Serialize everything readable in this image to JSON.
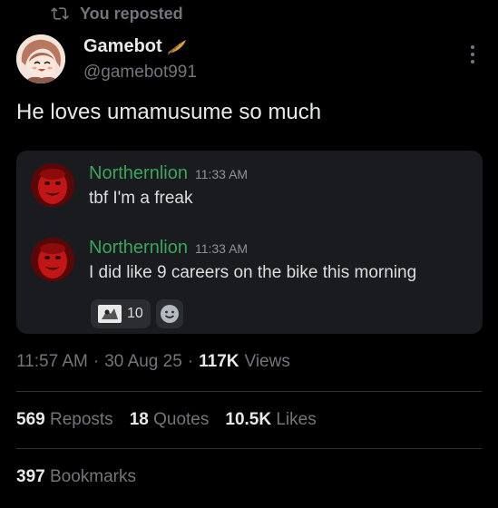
{
  "repost": {
    "label": "You reposted"
  },
  "author": {
    "name": "Gamebot",
    "handle": "@gamebot991"
  },
  "tweet": {
    "text": "He loves umamusume so much"
  },
  "embed": {
    "messages": [
      {
        "author": "Northernlion",
        "time": "11:33 AM",
        "text": "tbf I'm a freak"
      },
      {
        "author": "Northernlion",
        "time": "11:33 AM",
        "text": "I did like 9 careers on the bike this morning"
      }
    ],
    "reaction": {
      "count": "10"
    }
  },
  "meta": {
    "time": "11:57 AM",
    "date": "30 Aug 25",
    "views_count": "117K",
    "views_label": "Views"
  },
  "stats": {
    "reposts_count": "569",
    "reposts_label": "Reposts",
    "quotes_count": "18",
    "quotes_label": "Quotes",
    "likes_count": "10.5K",
    "likes_label": "Likes",
    "bookmarks_count": "397",
    "bookmarks_label": "Bookmarks"
  },
  "colors": {
    "background": "#000000",
    "muted": "#71767b",
    "discord_green": "#3ba55c",
    "embed_bg": "#1a1b1e"
  },
  "icons": {
    "repost": "repost-icon",
    "quill": "quill-icon",
    "more": "more-icon",
    "emoji": "emoji-icon"
  }
}
